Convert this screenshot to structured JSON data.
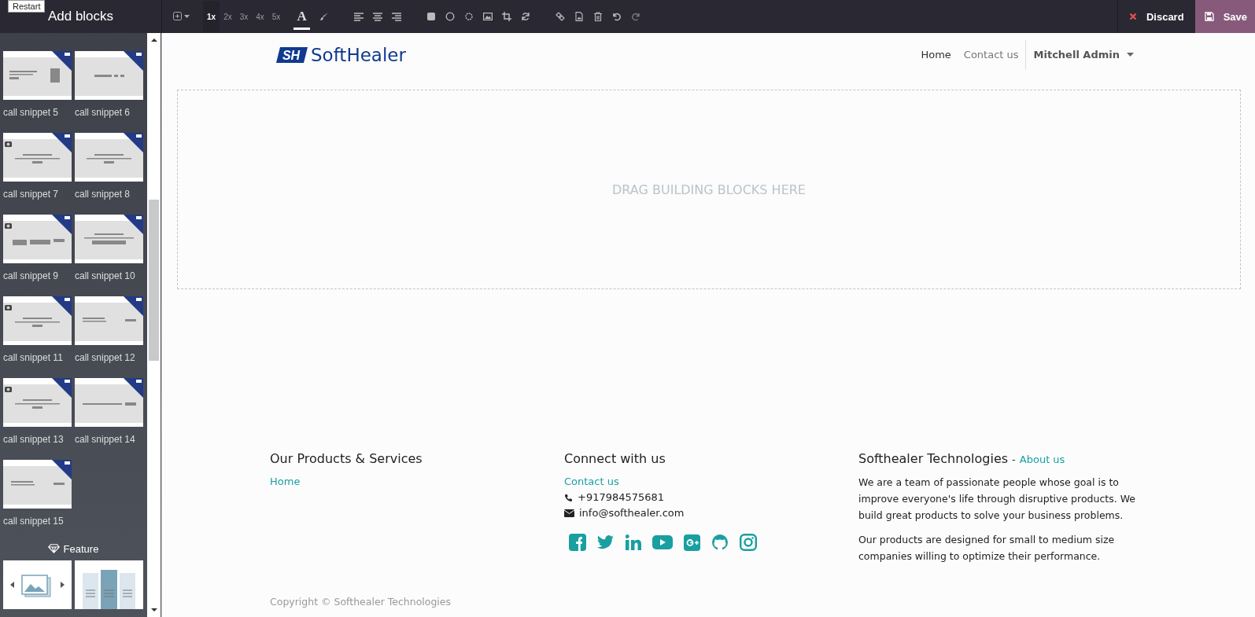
{
  "tooltip": "Restart",
  "sidebar": {
    "title": "Add blocks",
    "snippets": [
      {
        "label": "call snippet 5",
        "kind": "text-image",
        "camera": false
      },
      {
        "label": "call snippet 6",
        "kind": "dashes",
        "camera": false
      },
      {
        "label": "call snippet 7",
        "kind": "centered",
        "camera": true
      },
      {
        "label": "call snippet 8",
        "kind": "centered",
        "camera": false
      },
      {
        "label": "call snippet 9",
        "kind": "columns",
        "camera": true
      },
      {
        "label": "call snippet 10",
        "kind": "banner",
        "camera": false
      },
      {
        "label": "call snippet 11",
        "kind": "centered",
        "camera": true
      },
      {
        "label": "call snippet 12",
        "kind": "left-button",
        "camera": false
      },
      {
        "label": "call snippet 13",
        "kind": "centered",
        "camera": true
      },
      {
        "label": "call snippet 14",
        "kind": "line-button",
        "camera": false
      },
      {
        "label": "call snippet 15",
        "kind": "left-button",
        "camera": false
      }
    ],
    "section": "Feature"
  },
  "toolbar": {
    "zoom": [
      {
        "label": "1x",
        "selected": true
      },
      {
        "label": "2x",
        "selected": false
      },
      {
        "label": "3x",
        "selected": false
      },
      {
        "label": "4x",
        "selected": false
      },
      {
        "label": "5x",
        "selected": false
      }
    ],
    "font_button": {
      "label": "A",
      "selected": true
    },
    "discard": "Discard",
    "save": "Save"
  },
  "navbar": {
    "logo_mark": "SH",
    "logo_text": "SoftHealer",
    "links": [
      {
        "label": "Home",
        "selected": true
      },
      {
        "label": "Contact us",
        "selected": false
      }
    ],
    "user": "Mitchell Admin"
  },
  "dropzone": "DRAG BUILDING BLOCKS HERE",
  "footer": {
    "columns": [
      {
        "title": "Our Products & Services",
        "links": [
          "Home"
        ]
      },
      {
        "title": "Connect with us",
        "links": [
          "Contact us"
        ],
        "phone": "+917984575681",
        "email": "info@softhealer.com"
      },
      {
        "title": "Softhealer Technologies",
        "separator": "-",
        "link": "About us",
        "paragraphs": [
          "We are a team of passionate people whose goal is to improve everyone's life through disruptive products. We build great products to solve your business problems.",
          "Our products are designed for small to medium size companies willing to optimize their performance."
        ]
      }
    ],
    "copyright": "Copyright © Softhealer Technologies"
  }
}
